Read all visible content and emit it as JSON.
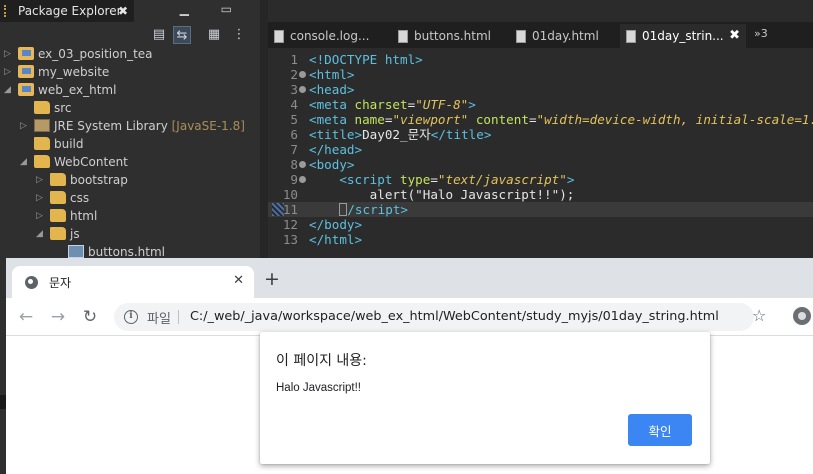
{
  "eclipse": {
    "explorer": {
      "tab_label": "Package Explorer",
      "close": "✖",
      "controls": "▁ ▭",
      "tools": [
        "▤",
        "⇆",
        "▦",
        "⋮"
      ],
      "tree": [
        {
          "label": "ex_03_position_tea",
          "icon": "project-icon",
          "expanded": false
        },
        {
          "label": "my_website",
          "icon": "project-icon",
          "expanded": false
        },
        {
          "label": "web_ex_html",
          "icon": "project-icon",
          "expanded": true
        },
        {
          "label": "src",
          "icon": "package-folder-icon",
          "expanded": null
        },
        {
          "label": "JRE System Library",
          "decoration": "[JavaSE-1.8]",
          "icon": "library-icon",
          "expanded": false
        },
        {
          "label": "build",
          "icon": "folder-icon",
          "expanded": null
        },
        {
          "label": "WebContent",
          "icon": "folder-icon",
          "expanded": true
        },
        {
          "label": "bootstrap",
          "icon": "folder-icon",
          "expanded": false
        },
        {
          "label": "css",
          "icon": "folder-icon",
          "expanded": false
        },
        {
          "label": "html",
          "icon": "folder-icon",
          "expanded": false
        },
        {
          "label": "js",
          "icon": "folder-icon",
          "expanded": true
        },
        {
          "label": "buttons.html",
          "icon": "html-file-icon",
          "expanded": null
        }
      ]
    },
    "editor": {
      "tabs": [
        "console.log...",
        "buttons.html",
        "01day.html",
        "01day_strin..."
      ],
      "selected_tab": "01day_strin...",
      "tab_close": "✖",
      "more_tabs": "»3",
      "line_numbers": [
        "1",
        "2",
        "3",
        "4",
        "5",
        "6",
        "7",
        "8",
        "9",
        "10",
        "11",
        "12",
        "13"
      ],
      "code": {
        "l1": "<!DOCTYPE html>",
        "l2": "<html>",
        "l3": "<head>",
        "l4_tag": "<meta",
        "l4_attr": " charset",
        "l4_eq": "=",
        "l4_val": "\"UTF-8\"",
        "l4_end": ">",
        "l5_tag": "<meta",
        "l5_attr1": " name",
        "l5_eq1": "=",
        "l5_val1": "\"viewport\"",
        "l5_attr2": " content",
        "l5_eq2": "=",
        "l5_val2": "\"width=device-width, initial-scale=1.0\"",
        "l5_end": ">",
        "l6_tag": "<title>",
        "l6_text": "Day02_문자",
        "l6_close": "</title>",
        "l7": "</head>",
        "l8": "<body>",
        "l9_tag": "    <script",
        "l9_attr": " type",
        "l9_eq": "=",
        "l9_val": "\"text/javascript\"",
        "l9_end": ">",
        "l10": "        alert(\"Halo Javascript!!\");",
        "l11_pre": "    ",
        "l11_close": "/script>",
        "l12": "</body>",
        "l13": "</html>"
      }
    }
  },
  "browser": {
    "tab_title": "문자",
    "tab_close": "✕",
    "new_tab": "+",
    "back": "←",
    "forward": "→",
    "reload": "↻",
    "address_label": "파일",
    "info_icon": "i",
    "url": "C:/_web/_java/workspace/web_ex_html/WebContent/study_myjs/01day_string.html",
    "star": "☆",
    "dialog": {
      "title": "이 페이지 내용:",
      "message": "Halo Javascript!!",
      "ok": "확인"
    }
  }
}
